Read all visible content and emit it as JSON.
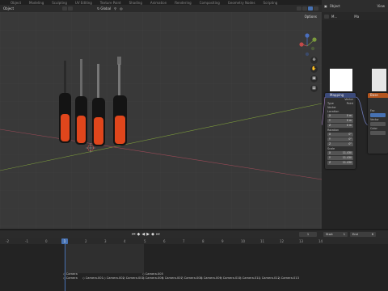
{
  "topbar": {
    "tabs": [
      "Object",
      "Modeling",
      "Sculpting",
      "UV Editing",
      "Texture Paint",
      "Shading",
      "Animation",
      "Rendering",
      "Compositing",
      "Geometry Nodes",
      "Scripting"
    ]
  },
  "viewport": {
    "mode_label": "Object",
    "transform_orientation": "Global",
    "options_label": "Options"
  },
  "side_panel": {
    "header_label": "Object",
    "header_view": "View",
    "row2_label": "M...",
    "row2_tag": "Ma"
  },
  "mapping_node": {
    "title": "Mapping",
    "output_label": "Vector",
    "type_label": "Type",
    "type_value": "Point",
    "vector_label": "Vector",
    "location_label": "Location",
    "location": [
      {
        "axis": "X",
        "value": "0 m"
      },
      {
        "axis": "Y",
        "value": "0 m"
      },
      {
        "axis": "Z",
        "value": "0 m"
      }
    ],
    "rotation_label": "Rotation",
    "rotation": [
      {
        "axis": "X",
        "value": "0°"
      },
      {
        "axis": "Y",
        "value": "0°"
      },
      {
        "axis": "Z",
        "value": "0°"
      }
    ],
    "scale_label": "Scale",
    "scale": [
      {
        "axis": "X",
        "value": "11.430"
      },
      {
        "axis": "Y",
        "value": "11.430"
      },
      {
        "axis": "Z",
        "value": "11.430"
      }
    ]
  },
  "second_node": {
    "title": "Base",
    "rows": [
      "Fac",
      "Vector",
      "Color"
    ]
  },
  "timeline": {
    "current_frame": "1",
    "start_label": "Start",
    "start_value": "1",
    "end_label": "End",
    "end_value": "6",
    "frame_field": "1",
    "ruler_ticks": [
      "-2",
      "-1",
      "0",
      "1",
      "2",
      "3",
      "4",
      "5",
      "6",
      "7",
      "8",
      "9",
      "10",
      "11",
      "12",
      "13",
      "14"
    ],
    "markers": [
      "Camera",
      "Camera",
      "Camera.001",
      "Camera.002",
      "Camera.003",
      "Camera.005",
      "Camera.006",
      "Camera.007",
      "Camera.008",
      "Camera.009",
      "Camera.010",
      "Camera.011",
      "Camera.012",
      "Camera.013"
    ]
  },
  "colors": {
    "accent": "#4772b3",
    "handle_orange": "#e0461c",
    "handle_black": "#141414",
    "node_header_blue": "#3b4a7a",
    "node_header_orange": "#b5561f"
  }
}
